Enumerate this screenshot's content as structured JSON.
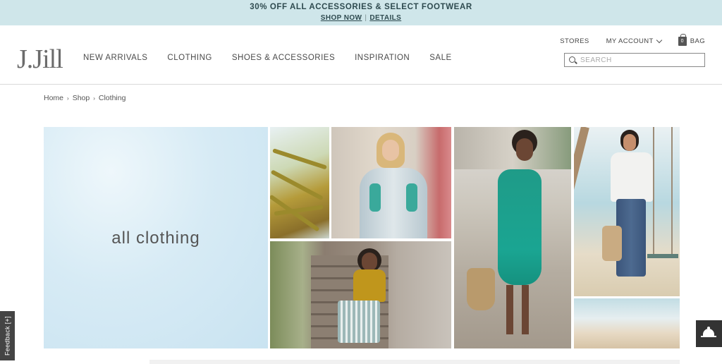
{
  "promo": {
    "title": "30% OFF ALL ACCESSORIES & SELECT FOOTWEAR",
    "shop_now": "SHOP NOW",
    "separator": "|",
    "details": "DETAILS"
  },
  "header": {
    "logo": "J.Jill",
    "nav": [
      {
        "label": "NEW ARRIVALS"
      },
      {
        "label": "CLOTHING"
      },
      {
        "label": "SHOES & ACCESSORIES"
      },
      {
        "label": "INSPIRATION"
      },
      {
        "label": "SALE"
      }
    ],
    "utility": {
      "stores": "STORES",
      "account": "MY ACCOUNT",
      "bag_count": "0",
      "bag": "BAG"
    },
    "search": {
      "placeholder": "SEARCH",
      "value": ""
    }
  },
  "breadcrumb": {
    "items": [
      "Home",
      "Shop",
      "Clothing"
    ],
    "arrow": "›"
  },
  "hero": {
    "title": "all clothing"
  },
  "photos": [
    {
      "name": "palm-leaves-photo"
    },
    {
      "name": "model-embroidered-tunic-photo"
    },
    {
      "name": "model-stone-stairs-photo"
    },
    {
      "name": "model-teal-dress-photo"
    },
    {
      "name": "model-beach-swing-photo"
    },
    {
      "name": "beach-shoreline-photo"
    }
  ],
  "feedback": {
    "label": "Feedback [+]"
  },
  "colors": {
    "promo_bg": "#cfe6ea",
    "text": "#4a4a4a",
    "hero_sky": "#c9e3f1"
  },
  "icons": {
    "search": "search-icon",
    "chevron": "chevron-down-icon",
    "bag": "shopping-bag-icon",
    "chat": "service-bell-icon"
  }
}
